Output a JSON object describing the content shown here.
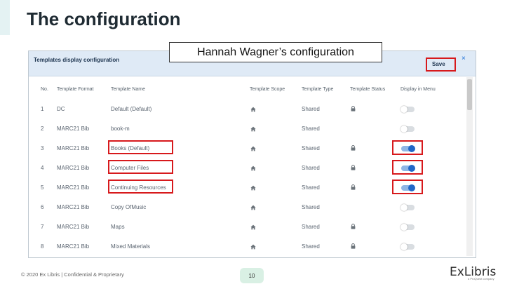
{
  "slide": {
    "title": "The configuration",
    "annotation": "Hannah Wagner’s configuration",
    "footer_copyright": "© 2020 Ex Libris | Confidential & Proprietary",
    "page_number": "10",
    "logo_text": "ExLibris",
    "logo_sub": "a ProQuest company"
  },
  "panel": {
    "title": "Templates display configuration",
    "save_label": "Save",
    "close_glyph": "×"
  },
  "table": {
    "headers": [
      "No.",
      "Template Format",
      "Template Name",
      "Template Scope",
      "Template Type",
      "Template Status",
      "Display in Menu"
    ],
    "rows": [
      {
        "no": "1",
        "format": "DC",
        "name": "Default (Default)",
        "type": "Shared",
        "locked": true,
        "display": false,
        "highlighted": false
      },
      {
        "no": "2",
        "format": "MARC21 Bib",
        "name": "book-m",
        "type": "Shared",
        "locked": false,
        "display": false,
        "highlighted": false
      },
      {
        "no": "3",
        "format": "MARC21 Bib",
        "name": "Books (Default)",
        "type": "Shared",
        "locked": true,
        "display": true,
        "highlighted": true
      },
      {
        "no": "4",
        "format": "MARC21 Bib",
        "name": "Computer Files",
        "type": "Shared",
        "locked": true,
        "display": true,
        "highlighted": true
      },
      {
        "no": "5",
        "format": "MARC21 Bib",
        "name": "Continuing Resources",
        "type": "Shared",
        "locked": true,
        "display": true,
        "highlighted": true
      },
      {
        "no": "6",
        "format": "MARC21 Bib",
        "name": "Copy OfMusic",
        "type": "Shared",
        "locked": false,
        "display": false,
        "highlighted": false
      },
      {
        "no": "7",
        "format": "MARC21 Bib",
        "name": "Maps",
        "type": "Shared",
        "locked": true,
        "display": false,
        "highlighted": false
      },
      {
        "no": "8",
        "format": "MARC21 Bib",
        "name": "Mixed Materials",
        "type": "Shared",
        "locked": true,
        "display": false,
        "highlighted": false
      }
    ]
  },
  "icons": {
    "scope": "home-icon",
    "status": "lock-icon"
  },
  "colors": {
    "highlight_red": "#d7191c",
    "toggle_on": "#2067c7",
    "header_bg": "#dfeaf6"
  }
}
